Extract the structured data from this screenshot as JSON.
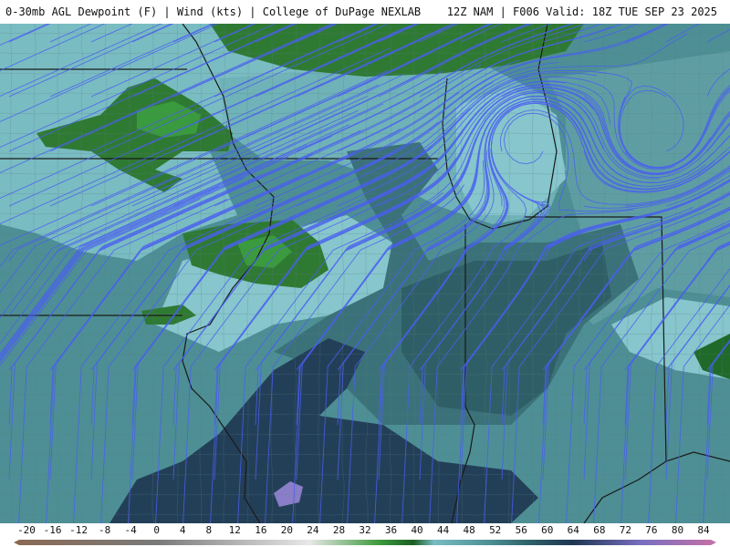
{
  "header": {
    "left_title": "0-30mb AGL Dewpoint (F) | Wind (kts) | College of DuPage NEXLAB",
    "right_title": "12Z NAM | F006 Valid: 18Z TUE SEP 23 2025"
  },
  "legend": {
    "ticks": [
      "-20",
      "-16",
      "-12",
      "-8",
      "-4",
      "0",
      "4",
      "8",
      "12",
      "16",
      "20",
      "24",
      "28",
      "32",
      "36",
      "40",
      "44",
      "48",
      "52",
      "56",
      "60",
      "64",
      "68",
      "72",
      "76",
      "80",
      "84"
    ],
    "colors": {
      "brown": "#8a6a55",
      "gray": "#7a7a7a",
      "light": "#e8e8e8",
      "green": "#3e9a3e",
      "darkgreen": "#1c5e22",
      "teal_light": "#79bcc2",
      "teal": "#4d8f94",
      "teal_dark": "#2f5f66",
      "navy": "#1e3652",
      "purple": "#7a6fc0",
      "pink": "#c070a8"
    }
  },
  "map": {
    "colors": {
      "base": "#4d8f94",
      "light_teal": "#79bcc2",
      "mid_teal": "#5e9ea3",
      "dark_teal": "#3b7279",
      "darker": "#2f5f66",
      "navy": "#233f58",
      "green": "#3a8a3a",
      "darkgreen": "#1f6a28",
      "purple": "#8a7ec8",
      "streamline": "#4a5ff0",
      "county": "#5a7c86",
      "state": "#1a1a1a"
    }
  }
}
